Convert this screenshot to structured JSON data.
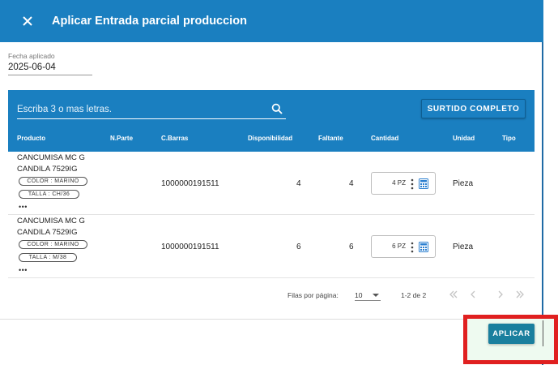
{
  "dialog": {
    "title": "Aplicar Entrada parcial produccion",
    "close_icon": "close-icon"
  },
  "date_field": {
    "label": "Fecha aplicado",
    "value": "2025-06-04"
  },
  "search": {
    "placeholder": "Escriba 3 o mas letras.",
    "icon": "search-icon"
  },
  "surtido_button": "SURTIDO COMPLETO",
  "table": {
    "headers": [
      "Producto",
      "N.Parte",
      "C.Barras",
      "Disponibilidad",
      "Faltante",
      "Cantidad",
      "Unidad",
      "Tipo"
    ],
    "rows": [
      {
        "product_line1": "CANCUMISA MC G",
        "product_line2": "CANDILA 7529IG",
        "chip_color": "COLOR : MARINO",
        "chip_talla": "TALLA : CH/36",
        "more": "•••",
        "barcode": "1000000191511",
        "disponibilidad": "4",
        "faltante": "4",
        "cantidad": "4 PZ",
        "unidad": "Pieza"
      },
      {
        "product_line1": "CANCUMISA MC G",
        "product_line2": "CANDILA 7529IG",
        "chip_color": "COLOR : MARINO",
        "chip_talla": "TALLA : M/38",
        "more": "•••",
        "barcode": "1000000191511",
        "disponibilidad": "6",
        "faltante": "6",
        "cantidad": "6 PZ",
        "unidad": "Pieza"
      }
    ]
  },
  "pagination": {
    "rows_label": "Filas por página:",
    "rows_value": "10",
    "range": "1-2 de 2"
  },
  "apply_button": "APLICAR",
  "colors": {
    "primary": "#1a7fc0",
    "apply": "#1a7f9e",
    "highlight": "#e02020"
  }
}
